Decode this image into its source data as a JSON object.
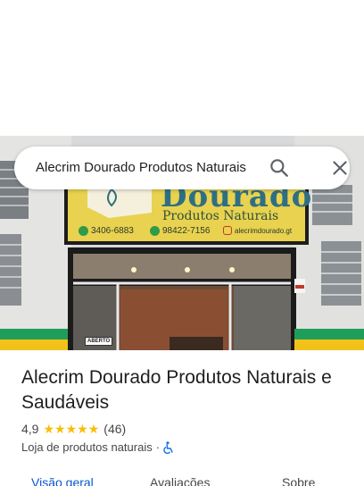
{
  "search": {
    "query": "Alecrim Dourado Produtos Naturais"
  },
  "photo": {
    "sign_brand": "Dourado",
    "sign_tagline": "Produtos Naturais",
    "sign_phone_1": "3406-6883",
    "sign_phone_2": "98422-7156",
    "sign_instagram": "alecrimdourado.gt",
    "door_sign": "ABERTO"
  },
  "place": {
    "title": "Alecrim Dourado Produtos Naturais e Saudáveis",
    "rating": "4,9",
    "stars": 5,
    "review_count": "(46)",
    "category": "Loja de produtos naturais",
    "separator": "·"
  },
  "tabs": [
    {
      "label": "Visão geral",
      "active": true
    },
    {
      "label": "Avaliações",
      "active": false
    },
    {
      "label": "Sobre",
      "active": false
    }
  ],
  "colors": {
    "accent": "#0b57d0",
    "star": "#fbbc04",
    "sign_yellow": "#e8d24f",
    "wall_green": "#1f9e5a",
    "wall_yellow": "#f2c21b"
  },
  "icons": {
    "search": "search-icon",
    "close": "close-icon",
    "accessibility": "wheelchair-icon"
  }
}
